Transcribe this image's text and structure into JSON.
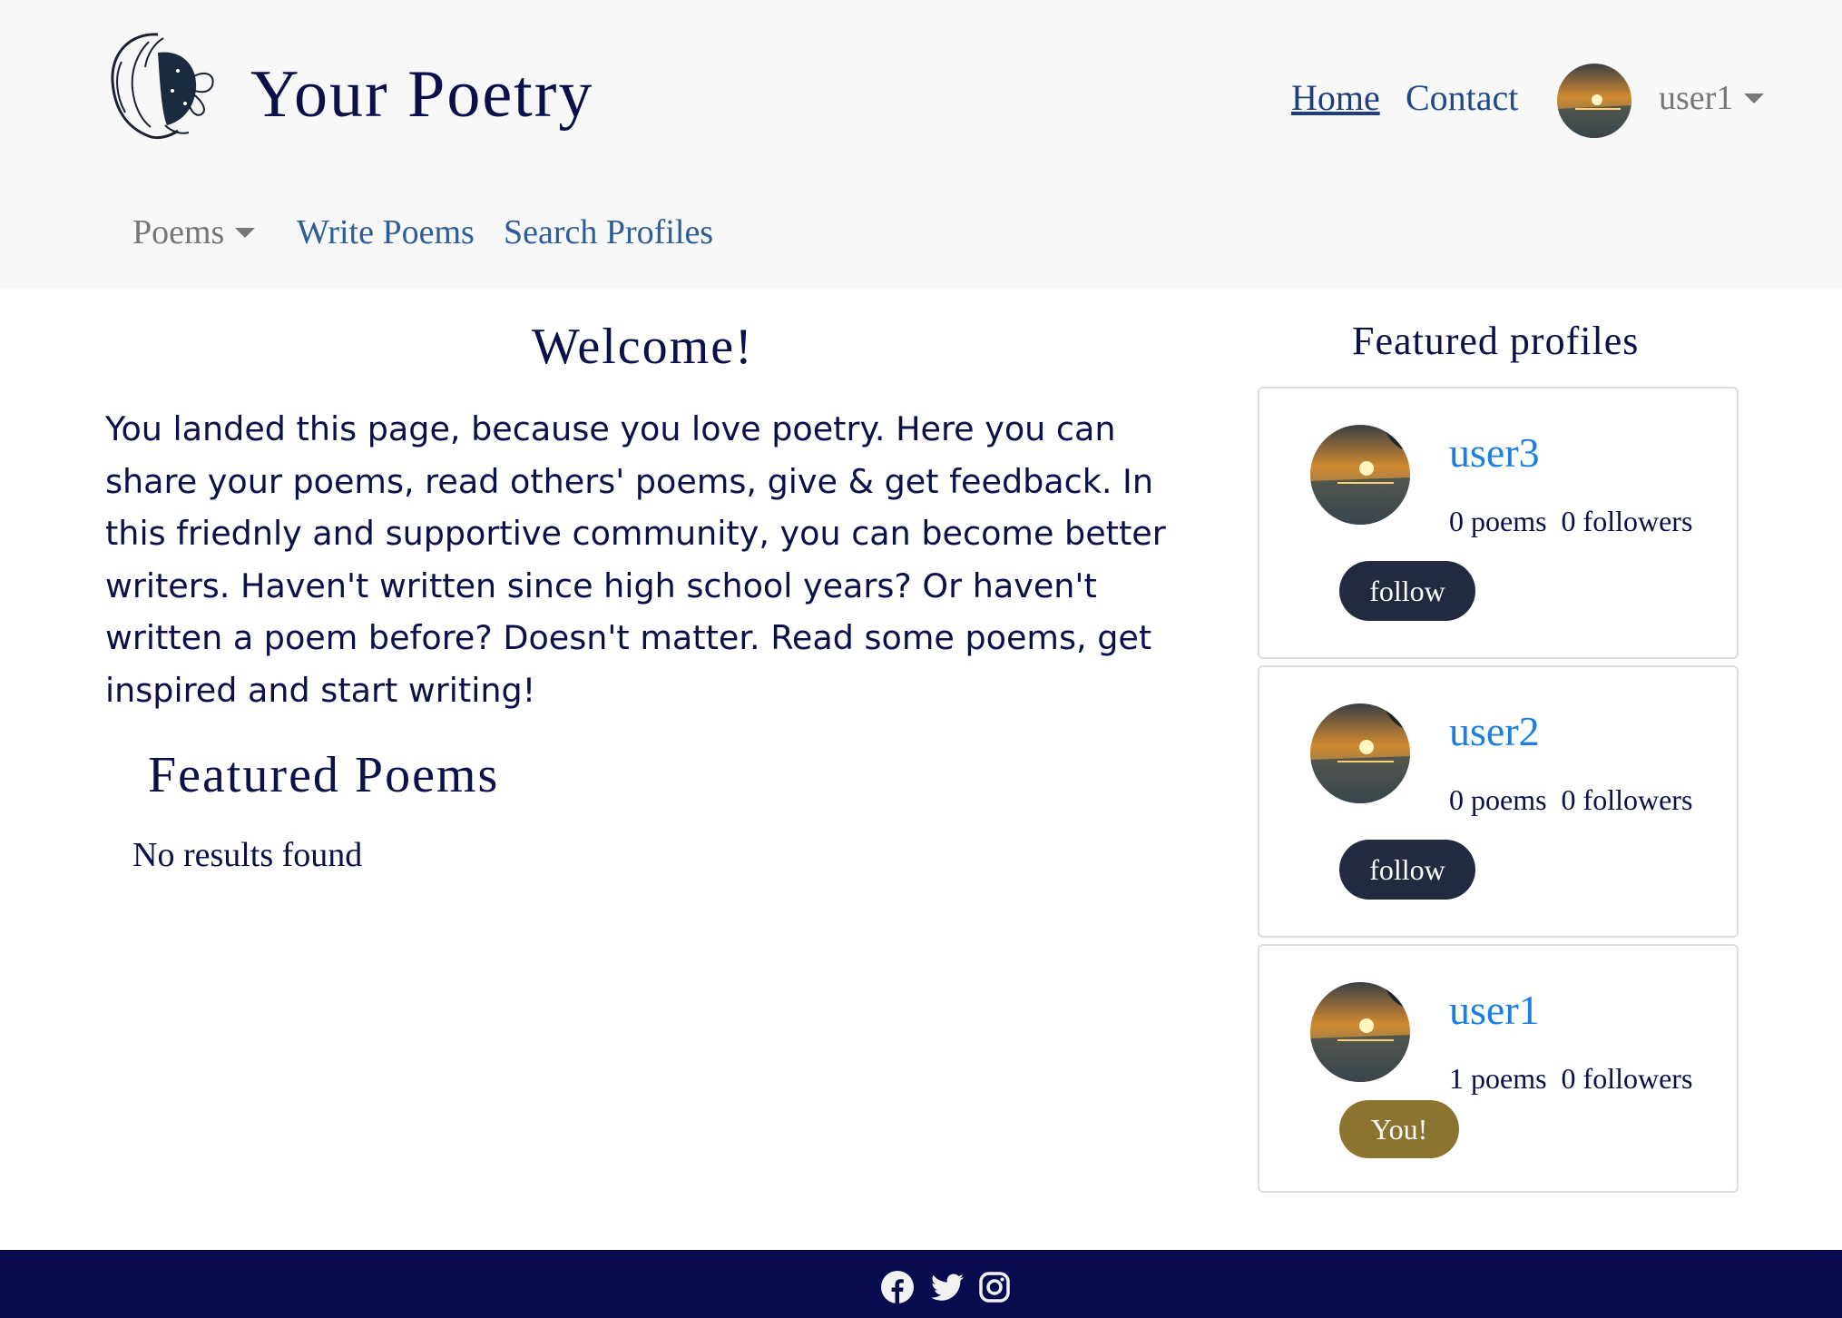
{
  "header": {
    "brand": "Your Poetry",
    "nav": {
      "home": "Home",
      "contact": "Contact"
    },
    "user_menu": "user1",
    "secondary_nav": {
      "poems": "Poems",
      "write": "Write Poems",
      "search": "Search Profiles"
    }
  },
  "main": {
    "welcome_title": "Welcome!",
    "intro_text": "You landed this page, because you love poetry. Here you can share your poems, read others' poems, give & get feedback. In this friednly and supportive community, you can become better writers. Haven't written since high school years? Or haven't written a poem before? Doesn't matter. Read some poems, get inspired and start writing!",
    "featured_poems_title": "Featured Poems",
    "no_results": "No results found"
  },
  "sidebar": {
    "title": "Featured profiles",
    "profiles": [
      {
        "name": "user3",
        "stats": "0 poems  0 followers",
        "action": "follow"
      },
      {
        "name": "user2",
        "stats": "0 poems  0 followers",
        "action": "follow"
      },
      {
        "name": "user1",
        "stats": "1 poems  0 followers",
        "action": "You!"
      }
    ]
  },
  "footer": {
    "icons": [
      "facebook-icon",
      "twitter-icon",
      "instagram-icon"
    ]
  },
  "colors": {
    "primary_text": "#0b0f4a",
    "link": "#1a7fe0",
    "follow_button": "#222a40",
    "you_badge": "#8b7330",
    "footer_bg": "#080b4e"
  }
}
